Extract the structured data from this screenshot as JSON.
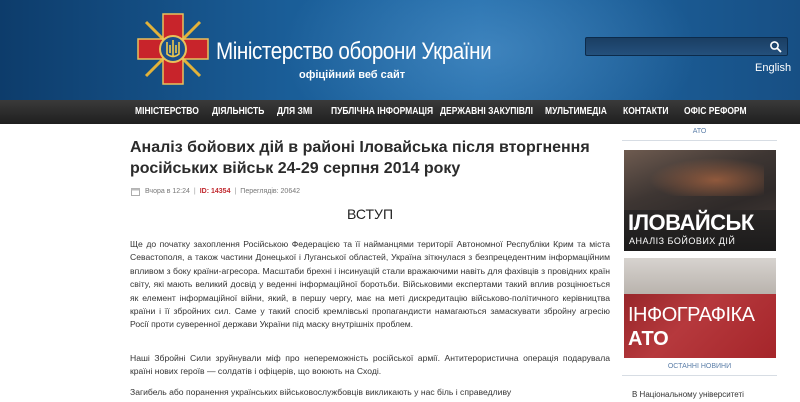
{
  "header": {
    "title": "Міністерство оборони України",
    "subtitle": "офіційний веб сайт",
    "search_placeholder": "",
    "language_link": "English",
    "emblem_icon": "ukraine-defense-cross-emblem",
    "colors": {
      "header_bg": "#1a5d97",
      "nav_bg": "#2a2a2a"
    }
  },
  "nav": {
    "items": [
      "МІНІСТЕРСТВО",
      "ДІЯЛЬНІСТЬ",
      "ДЛЯ ЗМІ",
      "ПУБЛІЧНА ІНФОРМАЦІЯ",
      "ДЕРЖАВНІ ЗАКУПІВЛІ",
      "МУЛЬТИМЕДІА",
      "КОНТАКТИ",
      "ОФІС РЕФОРМ"
    ]
  },
  "article": {
    "title": "Аналіз бойових дій в районі Іловайська після вторгнення російських військ 24-29 серпня 2014 року",
    "meta": {
      "date": "Вчора в 12:24",
      "id": "ID: 14354",
      "views": "Переглядів: 20642"
    },
    "section_heading": "ВСТУП",
    "paragraphs": [
      "Ще до початку захоплення Російською Федерацією та її найманцями території Автономної Республіки Крим та міста Севастополя, а також частини Донецької і Луганської областей, Україна зіткнулася з безпрецедентним інформаційним впливом з боку країни-агресора. Масштаби брехні і інсинуацій стали вражаючими навіть для фахівців з провідних країн світу, які мають великий досвід у веденні інформаційної боротьби. Військовими експертами такий вплив розцінюється як елемент інформаційної війни, який, в першу чергу, має на меті дискредитацію військово-політичного керівництва країни і її збройних сил. Саме у такий спосіб кремлівські пропагандисти намагаються замаскувати збройну агресію Росії проти суверенної держави України під маску внутрішніх проблем.",
      "Наші Збройні Сили зруйнували міф про непереможність російської армії. Антитерористична операція подарувала країні нових героїв — солдатів і офіцерів, що воюють на Сході.",
      "Загибель або поранення українських військовослужбовців викликають у нас біль і справедливу"
    ]
  },
  "sidebar": {
    "label": "АТО",
    "banner1": {
      "big": "ІЛОВАЙСЬК",
      "small": "АНАЛІЗ БОЙОВИХ ДІЙ"
    },
    "banner2": {
      "line1": "ІНФОГРАФІКА",
      "line2": "АТО"
    },
    "news_label": "ОСТАННІ НОВИНИ",
    "news_item": "В Національному університеті"
  }
}
